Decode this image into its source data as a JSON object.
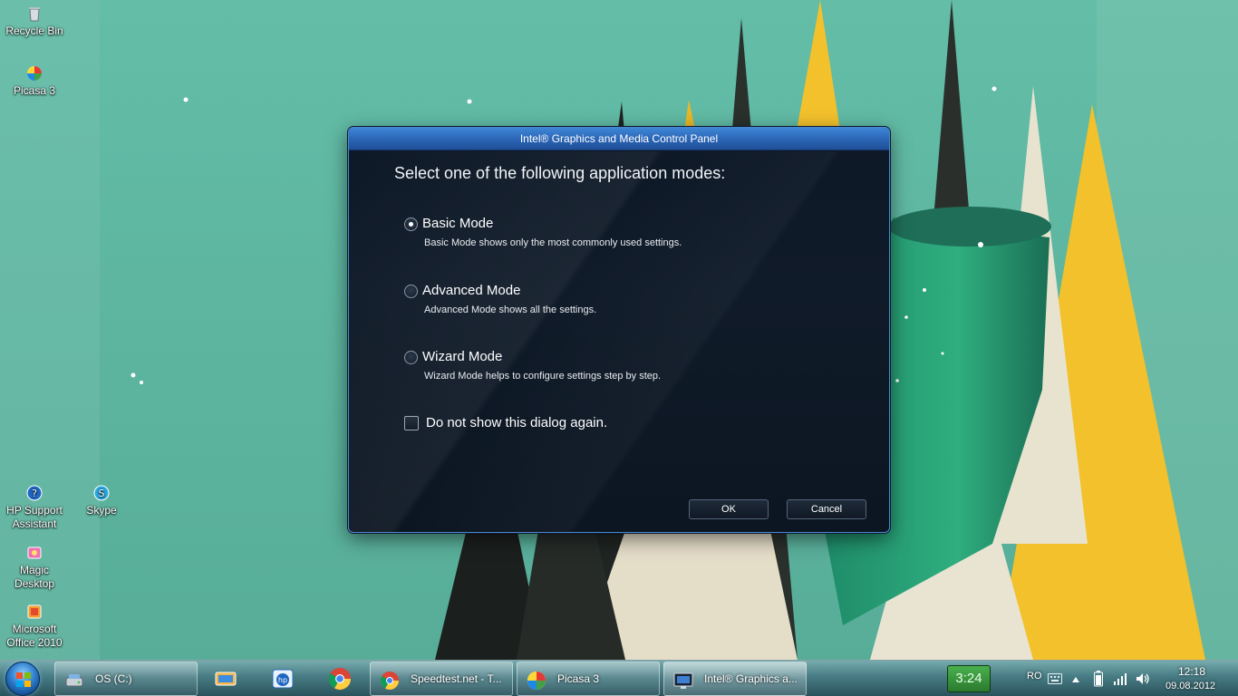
{
  "desktop": {
    "icons": [
      {
        "label": "Recycle Bin"
      },
      {
        "label": "Picasa 3"
      },
      {
        "label": "HP Support Assistant"
      },
      {
        "label": "Skype"
      },
      {
        "label": "Magic Desktop"
      },
      {
        "label": "Microsoft Office 2010"
      }
    ]
  },
  "dialog": {
    "title": "Intel® Graphics and Media Control Panel",
    "heading": "Select one of the following application modes:",
    "modes": [
      {
        "label": "Basic Mode",
        "description": "Basic Mode shows only the most commonly used settings.",
        "selected": true
      },
      {
        "label": "Advanced Mode",
        "description": "Advanced Mode shows all the settings.",
        "selected": false
      },
      {
        "label": "Wizard Mode",
        "description": "Wizard Mode helps to configure settings step by step.",
        "selected": false
      }
    ],
    "checkbox_label": "Do not show this dialog again.",
    "ok_label": "OK",
    "cancel_label": "Cancel"
  },
  "taskbar": {
    "drive_label": "OS (C:)",
    "windows": [
      {
        "label": "Speedtest.net - T..."
      },
      {
        "label": "Picasa 3"
      },
      {
        "label": "Intel® Graphics a..."
      }
    ],
    "counter": "3:24",
    "language": "RO",
    "time": "12:18",
    "date": "09.08.2012"
  },
  "colors": {
    "wallpaper_teal": "#5fb8a2",
    "dialog_title": "#2a64b4",
    "dialog_body": "#101b29",
    "accent_yellow": "#f3c12c"
  }
}
